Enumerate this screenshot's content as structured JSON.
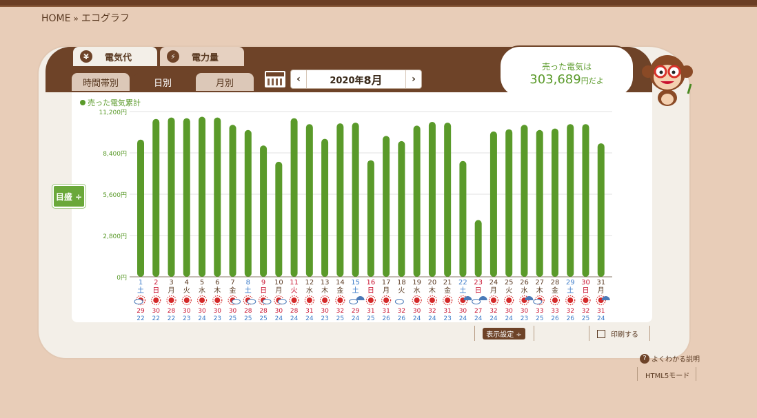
{
  "breadcrumb": {
    "home": "HOME",
    "separator": "»",
    "current": "エコグラフ"
  },
  "main_tabs": [
    {
      "label": "電気代",
      "icon": "yen-icon",
      "glyph": "¥",
      "active": true
    },
    {
      "label": "電力量",
      "icon": "bolt-icon",
      "glyph": "⚡",
      "active": false
    }
  ],
  "sub_tabs": [
    {
      "label": "時間帯別",
      "active": false
    },
    {
      "label": "日別",
      "active": true
    },
    {
      "label": "月別",
      "active": false
    }
  ],
  "date_nav": {
    "prev": "‹",
    "next": "›",
    "year_text": "2020年",
    "month_text": "8月"
  },
  "bubble": {
    "line1": "売った電気は",
    "amount": "303,689",
    "suffix": "円だよ"
  },
  "meyasu_label": "目盛 ÷",
  "buttons": {
    "display_settings": "表示設定 ÷",
    "print": "印刷する",
    "help": "よくわかる説明",
    "html5": "HTML5モード"
  },
  "colors": {
    "bar": "#5a9a2a",
    "brown": "#6e4328",
    "saturday": "#3a7ac8",
    "sunday": "#c8102e"
  },
  "chart_data": {
    "type": "bar",
    "legend": "売った電気累計",
    "y_ticks": [
      "0円",
      "2,800円",
      "5,600円",
      "8,400円",
      "11,200円"
    ],
    "ylim": [
      0,
      11200
    ],
    "days": [
      "1",
      "2",
      "3",
      "4",
      "5",
      "6",
      "7",
      "8",
      "9",
      "10",
      "11",
      "12",
      "13",
      "14",
      "15",
      "16",
      "17",
      "18",
      "19",
      "20",
      "21",
      "22",
      "23",
      "24",
      "25",
      "26",
      "27",
      "28",
      "29",
      "30",
      "31"
    ],
    "weekdays": [
      "土",
      "日",
      "月",
      "火",
      "水",
      "木",
      "金",
      "土",
      "日",
      "月",
      "火",
      "水",
      "木",
      "金",
      "土",
      "日",
      "月",
      "火",
      "水",
      "木",
      "金",
      "土",
      "日",
      "月",
      "火",
      "水",
      "木",
      "金",
      "土",
      "日",
      "月"
    ],
    "day_color": [
      "sat",
      "sun",
      "",
      "",
      "",
      "",
      "",
      "sat",
      "sun",
      "",
      "sun",
      "",
      "",
      "",
      "sat",
      "sun",
      "",
      "",
      "",
      "",
      "",
      "sat",
      "sun",
      "",
      "",
      "",
      "",
      "",
      "sat",
      "sun",
      ""
    ],
    "weather": [
      "cloud-sun",
      "sun",
      "sun",
      "sun",
      "sun",
      "sun",
      "sun-cloud",
      "sun-cloud",
      "sun-cloud",
      "sun-cloud",
      "sun",
      "sun",
      "sun",
      "sun",
      "cloud-rain",
      "sun",
      "sun",
      "cloud",
      "sun",
      "sun",
      "sun",
      "sun-rain",
      "cloud-rain",
      "sun",
      "sun",
      "sun-rain",
      "cloud-sun",
      "sun",
      "sun",
      "sun",
      "sun-rain"
    ],
    "high_temp": [
      "29",
      "30",
      "28",
      "30",
      "30",
      "30",
      "30",
      "28",
      "28",
      "30",
      "28",
      "31",
      "30",
      "32",
      "29",
      "31",
      "31",
      "32",
      "30",
      "32",
      "31",
      "30",
      "27",
      "32",
      "30",
      "30",
      "33",
      "33",
      "32",
      "32",
      "31"
    ],
    "low_temp": [
      "22",
      "22",
      "22",
      "23",
      "24",
      "23",
      "25",
      "25",
      "25",
      "24",
      "24",
      "24",
      "23",
      "25",
      "24",
      "25",
      "26",
      "26",
      "24",
      "24",
      "23",
      "24",
      "24",
      "24",
      "24",
      "23",
      "25",
      "26",
      "26",
      "25",
      "24"
    ],
    "values": [
      9300,
      10700,
      10800,
      10750,
      10850,
      10800,
      10300,
      9950,
      8900,
      7800,
      10750,
      10350,
      9350,
      10400,
      10450,
      7900,
      9550,
      9200,
      10250,
      10500,
      10450,
      7850,
      3850,
      9850,
      10000,
      10300,
      9950,
      10050,
      10350,
      10350,
      9050
    ]
  }
}
